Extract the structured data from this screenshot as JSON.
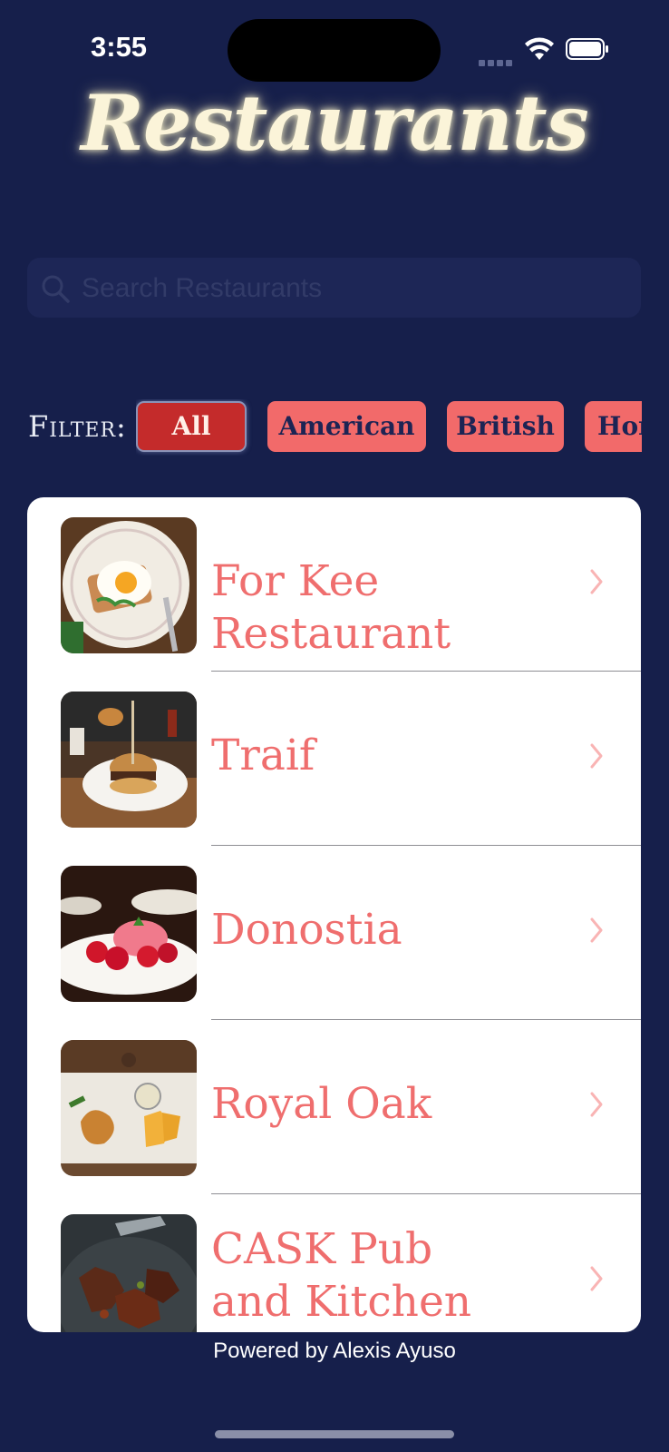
{
  "status_bar": {
    "time": "3:55"
  },
  "header": {
    "title": "Restaurants"
  },
  "search": {
    "placeholder": "Search Restaurants",
    "value": ""
  },
  "filter": {
    "label": "Filter:",
    "chips": [
      {
        "label": "All",
        "selected": true
      },
      {
        "label": "American",
        "selected": false
      },
      {
        "label": "British",
        "selected": false
      },
      {
        "label": "Hor",
        "selected": false
      }
    ]
  },
  "restaurants": [
    {
      "name": "For Kee Restaurant",
      "image": "fried-egg-toast-photo"
    },
    {
      "name": "Traif",
      "image": "burger-plate-photo"
    },
    {
      "name": "Donostia",
      "image": "strawberry-dessert-photo"
    },
    {
      "name": "Royal Oak",
      "image": "fish-and-chips-photo"
    },
    {
      "name": "CASK Pub and Kitchen",
      "image": "braised-meat-pot-photo"
    }
  ],
  "footer": {
    "text": "Powered by Alexis Ayuso"
  },
  "colors": {
    "background": "#161f4b",
    "accent": "#f26a6a",
    "selected_chip": "#c42b2b",
    "title_glow": "#fbf4d9"
  }
}
